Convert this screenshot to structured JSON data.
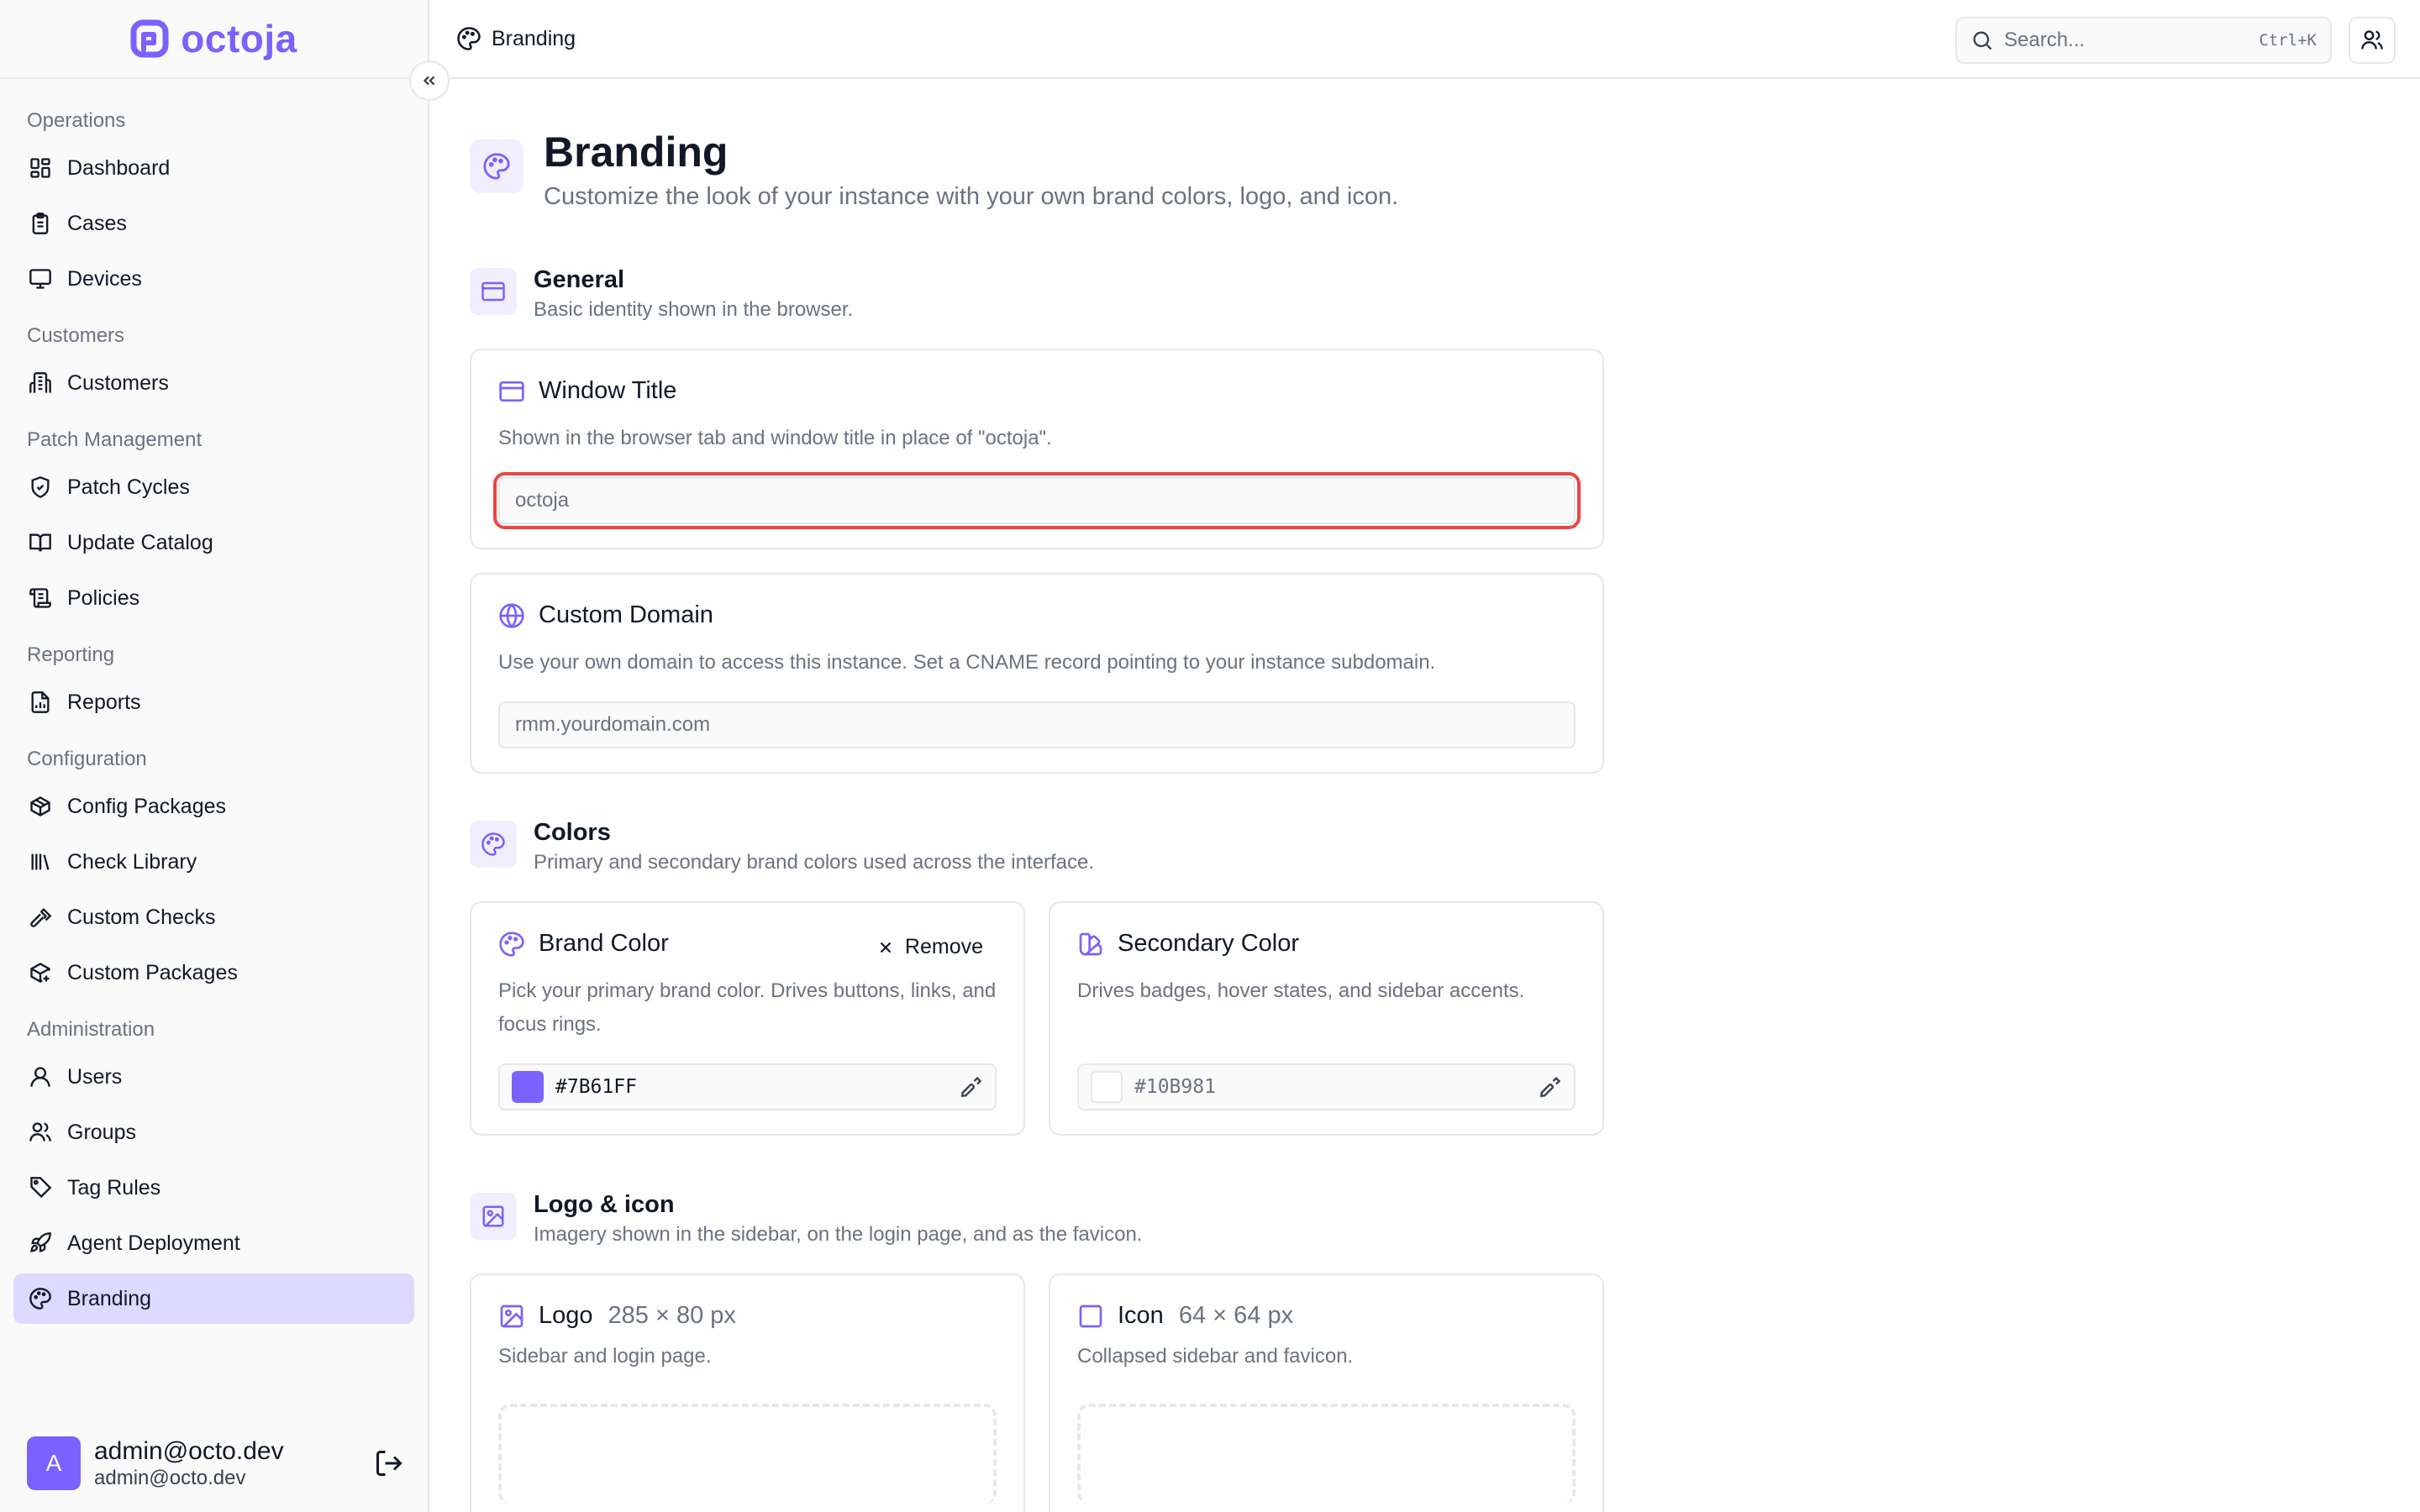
{
  "brand": {
    "name": "octoja",
    "accent": "#7B61FF"
  },
  "sidebar": {
    "groups": [
      {
        "label": "Operations",
        "items": [
          {
            "label": "Dashboard",
            "icon": "dashboard-icon"
          },
          {
            "label": "Cases",
            "icon": "clipboard-icon"
          },
          {
            "label": "Devices",
            "icon": "monitor-icon"
          }
        ]
      },
      {
        "label": "Customers",
        "items": [
          {
            "label": "Customers",
            "icon": "building-icon"
          }
        ]
      },
      {
        "label": "Patch Management",
        "items": [
          {
            "label": "Patch Cycles",
            "icon": "shield-icon"
          },
          {
            "label": "Update Catalog",
            "icon": "book-icon"
          },
          {
            "label": "Policies",
            "icon": "scroll-icon"
          }
        ]
      },
      {
        "label": "Reporting",
        "items": [
          {
            "label": "Reports",
            "icon": "report-icon"
          }
        ]
      },
      {
        "label": "Configuration",
        "items": [
          {
            "label": "Config Packages",
            "icon": "package-icon"
          },
          {
            "label": "Check Library",
            "icon": "library-icon"
          },
          {
            "label": "Custom Checks",
            "icon": "hammer-icon"
          },
          {
            "label": "Custom Packages",
            "icon": "package-plus-icon"
          }
        ]
      },
      {
        "label": "Administration",
        "items": [
          {
            "label": "Users",
            "icon": "user-icon"
          },
          {
            "label": "Groups",
            "icon": "users-icon"
          },
          {
            "label": "Tag Rules",
            "icon": "tag-icon"
          },
          {
            "label": "Agent Deployment",
            "icon": "rocket-icon"
          },
          {
            "label": "Branding",
            "icon": "palette-icon",
            "active": true
          }
        ]
      }
    ],
    "user": {
      "initial": "A",
      "name": "admin@octo.dev",
      "email": "admin@octo.dev"
    }
  },
  "topbar": {
    "breadcrumb": "Branding",
    "search_placeholder": "Search...",
    "search_shortcut": "Ctrl+K"
  },
  "page": {
    "title": "Branding",
    "subtitle": "Customize the look of your instance with your own brand colors, logo, and icon."
  },
  "general": {
    "title": "General",
    "subtitle": "Basic identity shown in the browser.",
    "window_title": {
      "label": "Window Title",
      "description": "Shown in the browser tab and window title in place of \"octoja\".",
      "placeholder": "octoja"
    },
    "custom_domain": {
      "label": "Custom Domain",
      "description": "Use your own domain to access this instance. Set a CNAME record pointing to your instance subdomain.",
      "placeholder": "rmm.yourdomain.com"
    }
  },
  "colors": {
    "title": "Colors",
    "subtitle": "Primary and secondary brand colors used across the interface.",
    "brand_color": {
      "label": "Brand Color",
      "remove_label": "Remove",
      "description": "Pick your primary brand color. Drives buttons, links, and focus rings.",
      "value": "#7B61FF",
      "swatch": "#7B61FF"
    },
    "secondary_color": {
      "label": "Secondary Color",
      "description": "Drives badges, hover states, and sidebar accents.",
      "placeholder": "#10B981"
    }
  },
  "logo_icon": {
    "title": "Logo & icon",
    "subtitle": "Imagery shown in the sidebar, on the login page, and as the favicon.",
    "logo": {
      "label": "Logo",
      "size": "285 × 80 px",
      "description": "Sidebar and login page."
    },
    "icon": {
      "label": "Icon",
      "size": "64 × 64 px",
      "description": "Collapsed sidebar and favicon."
    }
  }
}
